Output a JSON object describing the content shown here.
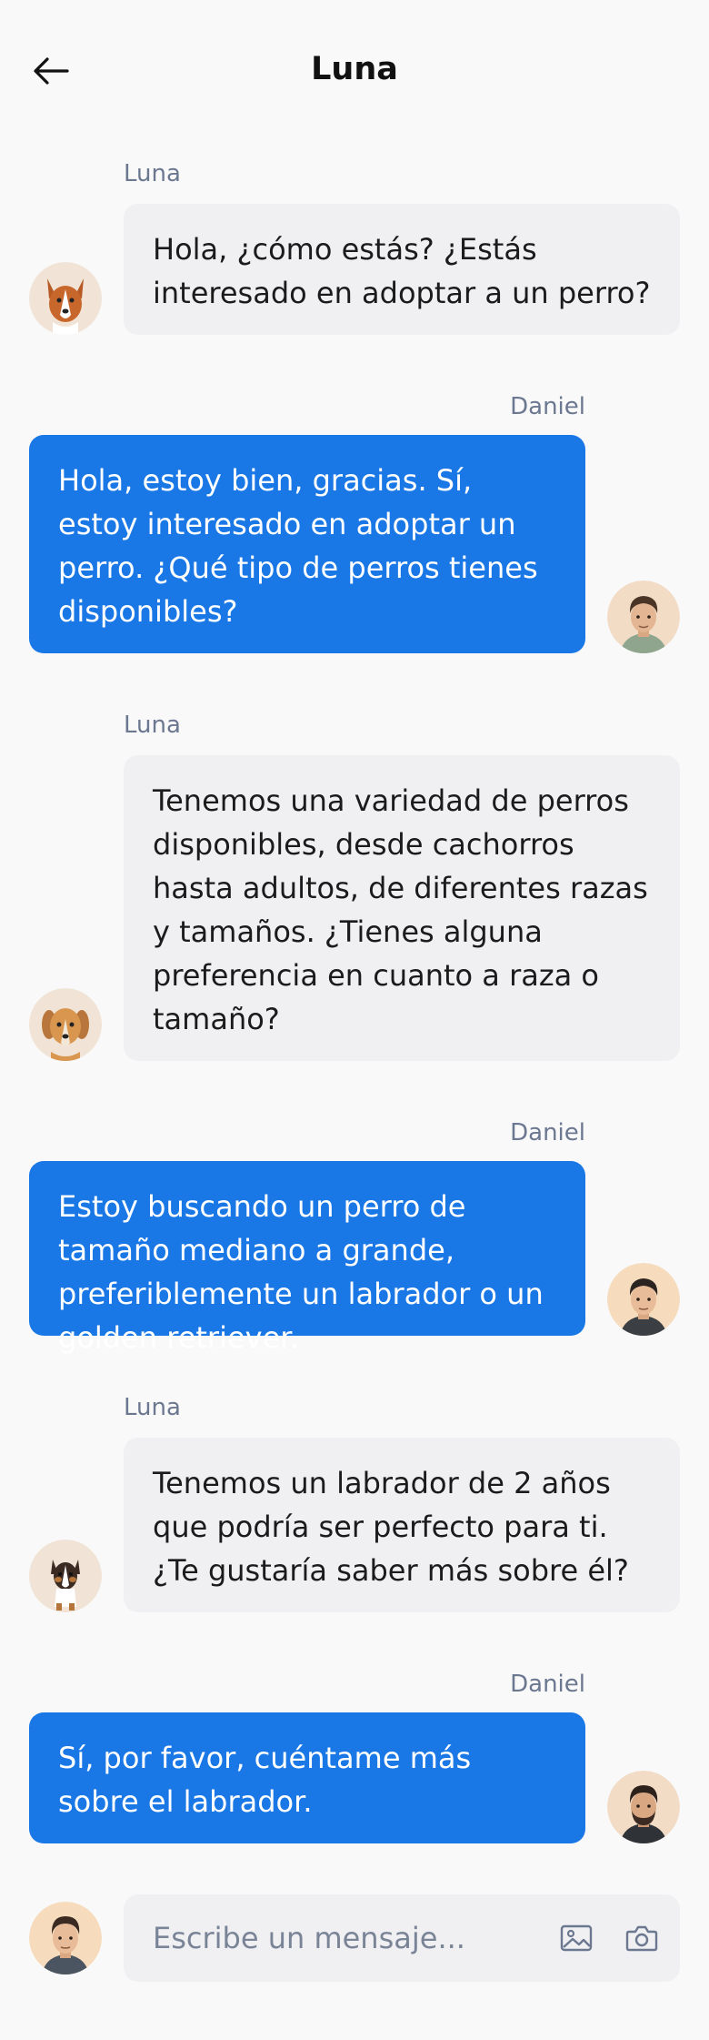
{
  "header": {
    "title": "Luna",
    "back_icon": "arrow-left-icon"
  },
  "messages": [
    {
      "sender": "Luna",
      "text": "Hola, ¿cómo estás? ¿Estás interesado en adoptar a un perro?",
      "direction": "incoming",
      "avatar": "dog-avatar-corgi"
    },
    {
      "sender": "Daniel",
      "text": "Hola, estoy bien, gracias. Sí, estoy interesado en adoptar un perro. ¿Qué tipo de perros tienes disponibles?",
      "direction": "outgoing",
      "avatar": "man-avatar-green-shirt"
    },
    {
      "sender": "Luna",
      "text": "Tenemos una variedad de perros disponibles, desde cachorros hasta adultos, de diferentes razas y tamaños. ¿Tienes alguna preferencia en cuanto a raza o tamaño?",
      "direction": "incoming",
      "avatar": "dog-avatar-golden"
    },
    {
      "sender": "Daniel",
      "text": "Estoy buscando un perro de tamaño mediano a grande, preferiblemente un labrador o un golden retriever.",
      "direction": "outgoing",
      "avatar": "man-avatar-dark-shirt"
    },
    {
      "sender": "Luna",
      "text": "Tenemos un labrador de 2 años que podría ser perfecto para ti. ¿Te gustaría saber más sobre él?",
      "direction": "incoming",
      "avatar": "dog-avatar-aussie"
    },
    {
      "sender": "Daniel",
      "text": "Sí, por favor, cuéntame más sobre el labrador.",
      "direction": "outgoing",
      "avatar": "man-avatar-beard"
    }
  ],
  "composer": {
    "placeholder": "Escribe un mensaje...",
    "image_icon": "image-icon",
    "camera_icon": "camera-icon",
    "avatar": "man-avatar-user"
  },
  "colors": {
    "outgoing_bubble": "#1a77e6",
    "incoming_bubble": "#f0f0f2",
    "sender_label": "#6b7890",
    "background": "#f9f9fa"
  }
}
